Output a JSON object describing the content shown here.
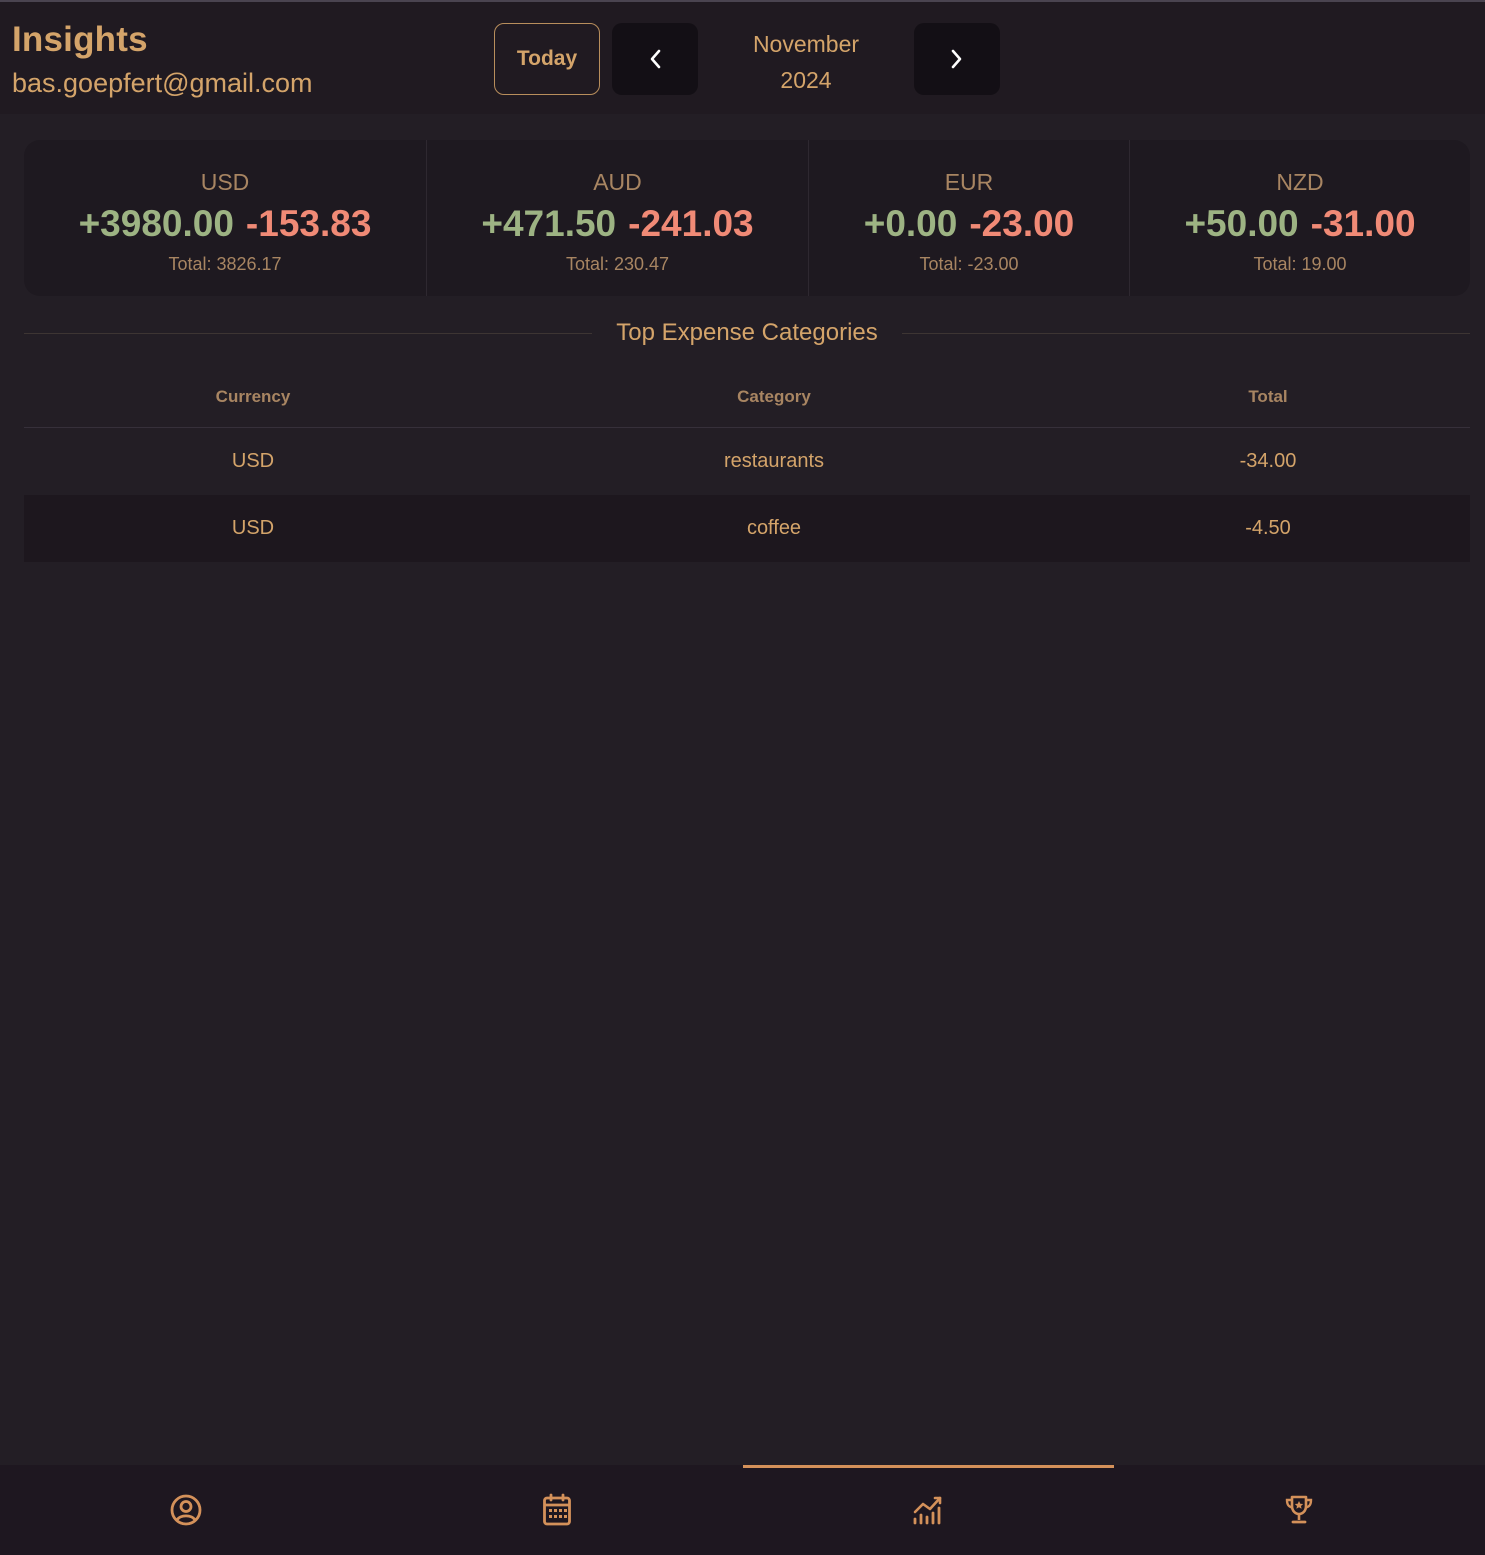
{
  "header": {
    "title": "Insights",
    "email": "bas.goepfert@gmail.com",
    "today_label": "Today",
    "month": "November",
    "year": "2024"
  },
  "currencies": [
    {
      "code": "USD",
      "income": "+3980.00",
      "expense": "-153.83",
      "total": "Total: 3826.17"
    },
    {
      "code": "AUD",
      "income": "+471.50",
      "expense": "-241.03",
      "total": "Total: 230.47"
    },
    {
      "code": "EUR",
      "income": "+0.00",
      "expense": "-23.00",
      "total": "Total: -23.00"
    },
    {
      "code": "NZD",
      "income": "+50.00",
      "expense": "-31.00",
      "total": "Total: 19.00"
    }
  ],
  "top_expenses": {
    "title": "Top Expense Categories",
    "columns": [
      "Currency",
      "Category",
      "Total"
    ],
    "rows": [
      [
        "USD",
        "restaurants",
        "-34.00"
      ],
      [
        "USD",
        "coffee",
        "-4.50"
      ]
    ]
  },
  "bottom_nav": {
    "items": [
      {
        "icon": "profile-icon"
      },
      {
        "icon": "calendar-icon"
      },
      {
        "icon": "insights-chart-icon",
        "active": true
      },
      {
        "icon": "trophy-icon"
      }
    ]
  },
  "colors": {
    "accent": "#d4a46a",
    "income": "#9db383",
    "expense": "#f08a76",
    "background": "#231e25"
  }
}
